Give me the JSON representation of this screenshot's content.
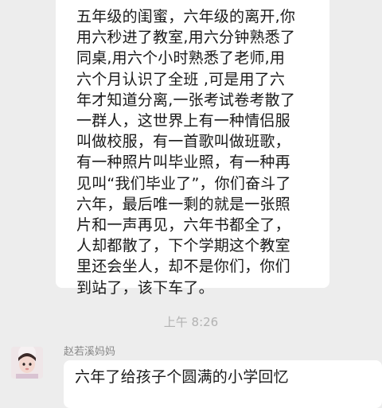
{
  "messages": [
    {
      "lines": [
        "五年级的闺蜜，六年级的离开,你",
        "用六秒进了教室,用六分钟熟悉了",
        "同桌,用六个小时熟悉了老师,用",
        "六个月认识了全班 ,可是用了六",
        "年才知道分离,一张考试卷考散了",
        "一群人，这世界上有一种情侣服",
        "叫做校服，有一首歌叫做班歌，",
        "有一种照片叫毕业照，有一种再",
        "见叫“我们毕业了”，你们奋斗了",
        "六年，最后唯一剩的就是一张照",
        "片和一声再见，六年书都全了，",
        "人却都散了，下个学期这个教室",
        "里还会坐人，却不是你们，你们",
        "到站了，该下车了。"
      ]
    }
  ],
  "timestamp": "上午 8:26",
  "next_message": {
    "sender": "赵若溪妈妈",
    "text": "六年了给孩子个圆满的小学回忆"
  },
  "colors": {
    "background": "#ededed",
    "bubble": "#ffffff",
    "text": "#1a1a1a",
    "timestamp": "#b2b2b2",
    "sender": "#888888"
  }
}
